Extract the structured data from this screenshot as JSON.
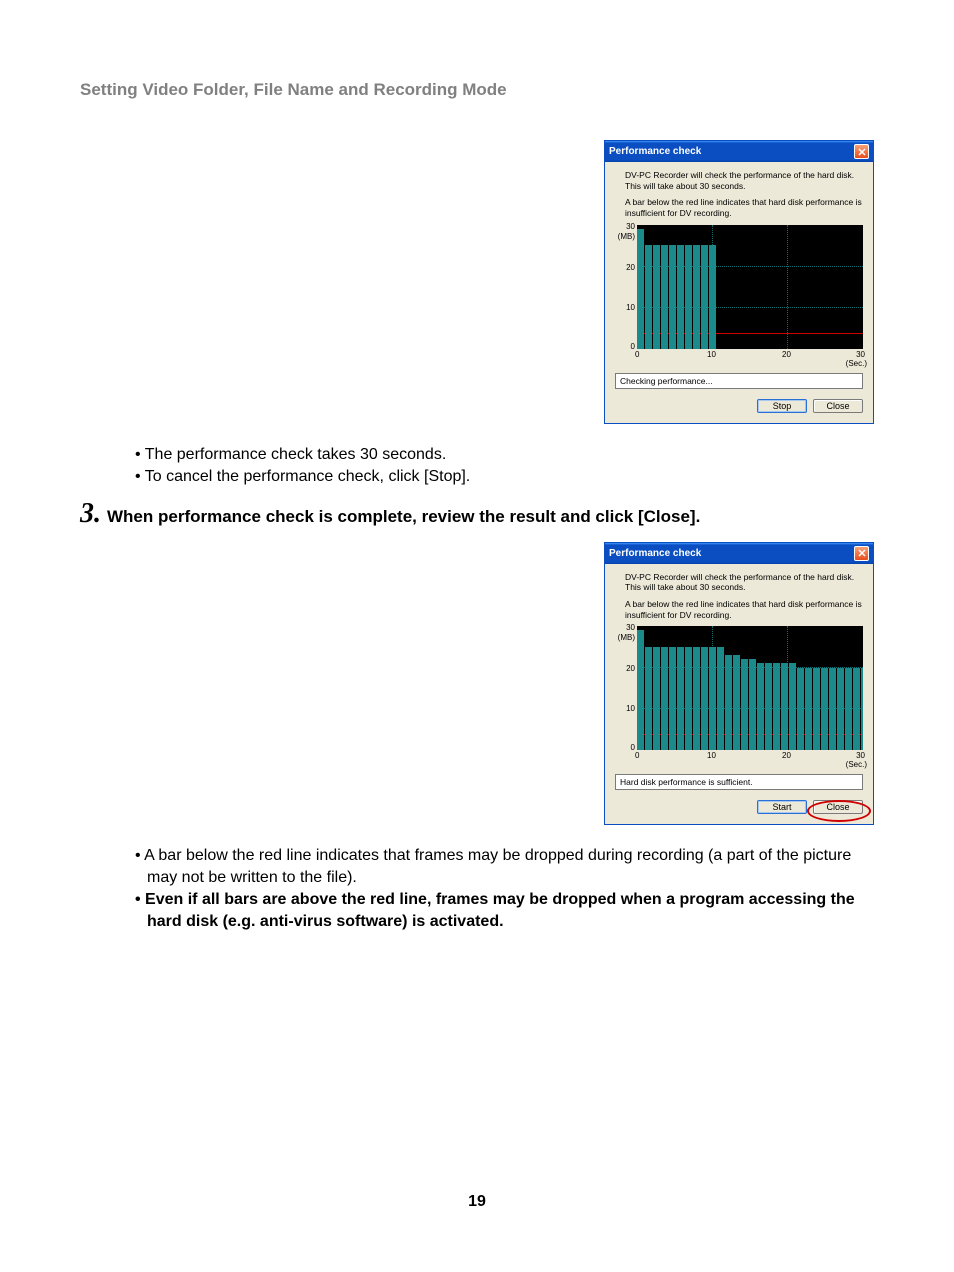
{
  "page_title": "Setting Video Folder, File Name and Recording Mode",
  "dialog1": {
    "title": "Performance check",
    "desc1": "DV-PC Recorder will check the performance of the hard disk. This will take about 30 seconds.",
    "desc2": "A bar below the red line indicates that hard disk performance is insufficient for DV recording.",
    "status": "Checking performance...",
    "btn_stop": "Stop",
    "btn_close": "Close",
    "y_axis": {
      "l30": "30",
      "lmb": "(MB)",
      "l20": "20",
      "l10": "10",
      "l0": "0"
    },
    "x_axis": {
      "l0": "0",
      "l10": "10",
      "l20": "20",
      "l30": "30",
      "sec": "(Sec.)"
    }
  },
  "bullets_a": {
    "b1": "The performance check takes 30 seconds.",
    "b2": "To cancel the performance check, click [Stop]."
  },
  "step3": {
    "num": "3.",
    "text": "When performance check is complete, review the result and click [Close]."
  },
  "dialog2": {
    "title": "Performance check",
    "desc1": "DV-PC Recorder will check the performance of the hard disk. This will take about 30 seconds.",
    "desc2": "A bar below the red line indicates that hard disk performance is insufficient for DV recording.",
    "status": "Hard disk performance is sufficient.",
    "btn_start": "Start",
    "btn_close": "Close",
    "y_axis": {
      "l30": "30",
      "lmb": "(MB)",
      "l20": "20",
      "l10": "10",
      "l0": "0"
    },
    "x_axis": {
      "l0": "0",
      "l10": "10",
      "l20": "20",
      "l30": "30",
      "sec": "(Sec.)"
    }
  },
  "bullets_b": {
    "b1": "A bar below the red line indicates that frames may be dropped during recording (a part of the picture may not be written to the file).",
    "b2": "Even if all bars are above the red line, frames may be dropped when a program accessing the hard disk (e.g. anti-virus software) is activated."
  },
  "page_number": "19",
  "chart_data": [
    {
      "type": "bar",
      "title": "Performance check (in progress)",
      "xlabel": "(Sec.)",
      "ylabel": "(MB)",
      "ylim": [
        0,
        30
      ],
      "xlim": [
        0,
        30
      ],
      "threshold_line_y": 4,
      "x": [
        0,
        1,
        2,
        3,
        4,
        5,
        6,
        7,
        8,
        9
      ],
      "values": [
        29,
        25,
        25,
        25,
        25,
        25,
        25,
        25,
        25,
        25
      ]
    },
    {
      "type": "bar",
      "title": "Performance check (complete)",
      "xlabel": "(Sec.)",
      "ylabel": "(MB)",
      "ylim": [
        0,
        30
      ],
      "xlim": [
        0,
        30
      ],
      "threshold_line_y": 4,
      "x": [
        0,
        1,
        2,
        3,
        4,
        5,
        6,
        7,
        8,
        9,
        10,
        11,
        12,
        13,
        14,
        15,
        16,
        17,
        18,
        19,
        20,
        21,
        22,
        23,
        24,
        25,
        26,
        27,
        28,
        29
      ],
      "values": [
        29,
        25,
        25,
        25,
        25,
        25,
        25,
        25,
        25,
        25,
        25,
        23,
        23,
        22,
        22,
        21,
        21,
        21,
        21,
        21,
        20,
        20,
        20,
        20,
        20,
        20,
        20,
        20,
        20,
        20
      ]
    }
  ]
}
